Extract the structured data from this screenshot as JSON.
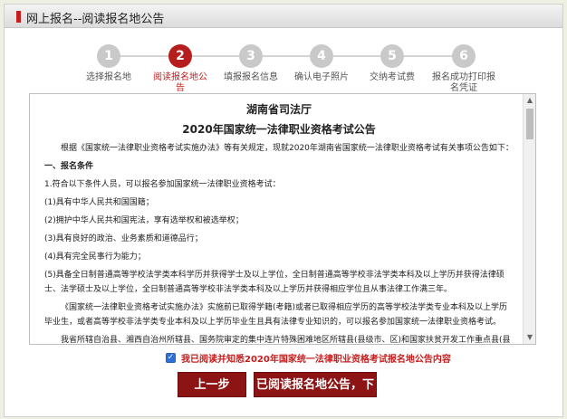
{
  "header": {
    "title": "网上报名--阅读报名地公告"
  },
  "steps": [
    {
      "num": "1",
      "label": "选择报名地",
      "active": false
    },
    {
      "num": "2",
      "label": "阅读报名地公告",
      "active": true
    },
    {
      "num": "3",
      "label": "填报报名信息",
      "active": false
    },
    {
      "num": "4",
      "label": "确认电子照片",
      "active": false
    },
    {
      "num": "5",
      "label": "交纳考试费",
      "active": false
    },
    {
      "num": "6",
      "label": "报名成功打印报名凭证",
      "active": false
    }
  ],
  "notice": {
    "org": "湖南省司法厅",
    "title": "2020年国家统一法律职业资格考试公告",
    "paragraphs": [
      "根据《国家统一法律职业资格考试实施办法》等有关规定，现就2020年湖南省国家统一法律职业资格考试有关事项公告如下：",
      "一、报名条件",
      "1.符合以下条件人员，可以报名参加国家统一法律职业资格考试：",
      "(1)具有中华人民共和国国籍；",
      "(2)拥护中华人民共和国宪法，享有选举权和被选举权；",
      "(3)具有良好的政治、业务素质和道德品行；",
      "(4)具有完全民事行为能力；",
      "(5)具备全日制普通高等学校法学类本科学历并获得学士及以上学位，全日制普通高等学校非法学类本科及以上学历并获得法律硕士、法学硕士及以上学位，全日制普通高等学校非法学类本科及以上学历并获得相应学位且从事法律工作满三年。",
      "《国家统一法律职业资格考试实施办法》实施前已取得学籍(考籍)或者已取得相应学历的高等学校法学类专业本科及以上学历毕业生，或者高等学校非法学类专业本科及以上学历毕业生且具有法律专业知识的，可以报名参加国家统一法律职业资格考试。",
      "我省所辖自治县、湘西自治州所辖县、国务院审定的集中连片特殊困难地区所辖县(县级市、区)和国家扶贫开发工作重点县(县级市、区)，包括新邵县、邵阳县、隆回县、洞口县、绥宁县、新宁县、城步苗族自治县、武冈市、石门县、慈利县、桑植县、中方县、沅陵县、辰溪县、溆浦县、会同县、麻阳苗族自治县、新晃侗族自治县、芷江侗族自治县、靖州苗族侗族自治县、通道侗族自治县、新化县、涟源市、泸溪县、凤凰县、保靖县、古丈县、永顺县、龙山县、花垣县、茶陵县、炎陵县、宜章县、汝城县、桂东县、安仁县、安化县、平江县、"
    ]
  },
  "agreement": {
    "checked": true,
    "label": "我已阅读并知悉2020年国家统一法律职业资格考试报名地公告内容"
  },
  "buttons": {
    "prev": "上一步",
    "next": "已阅读报名地公告，下一步"
  }
}
